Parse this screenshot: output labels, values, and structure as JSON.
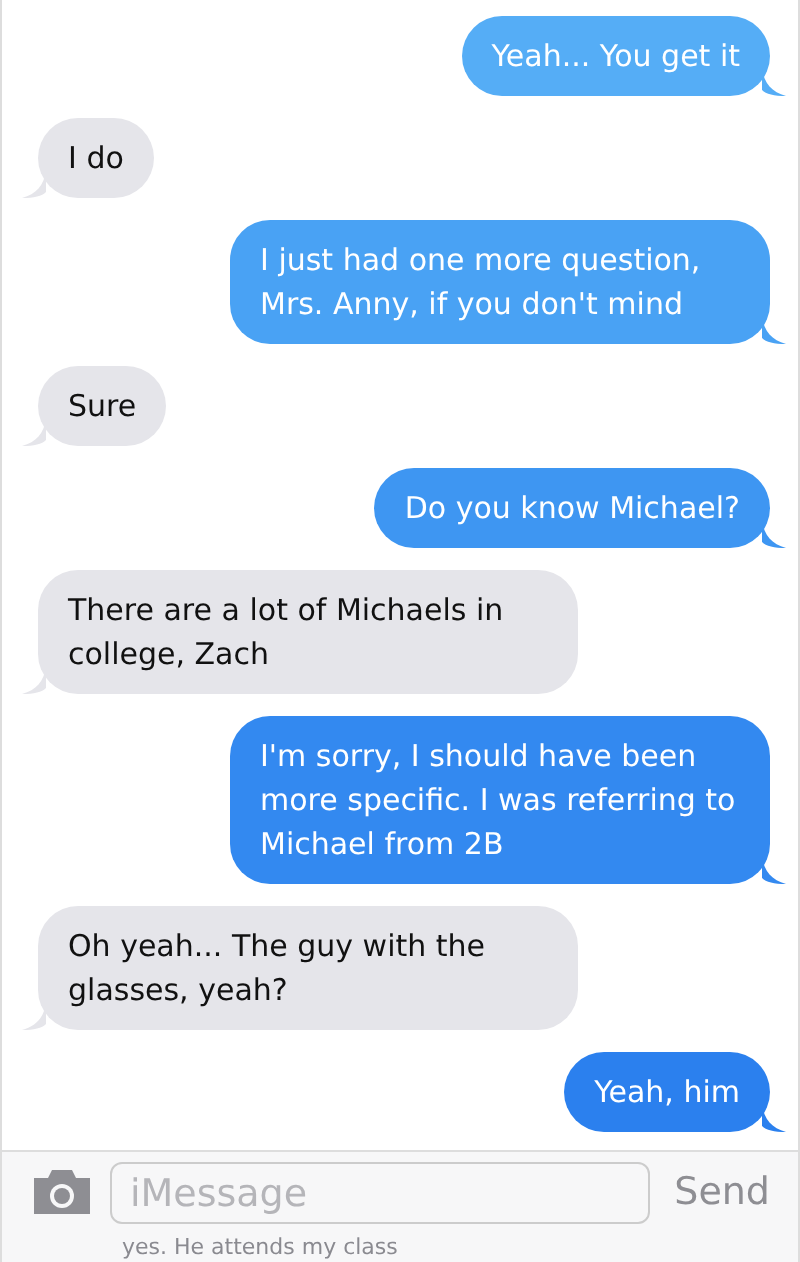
{
  "messages": [
    {
      "kind": "sent",
      "text": "Yeah... You get it"
    },
    {
      "kind": "received",
      "text": "I do"
    },
    {
      "kind": "sent",
      "text": "I just had one more question, Mrs. Anny, if you don't mind"
    },
    {
      "kind": "received",
      "text": "Sure"
    },
    {
      "kind": "sent",
      "text": "Do you know Michael?"
    },
    {
      "kind": "received",
      "text": "There are a lot of Michaels in college, Zach"
    },
    {
      "kind": "sent",
      "text": "I'm sorry, I should have been more specific. I was referring to Michael from 2B"
    },
    {
      "kind": "received",
      "text": "Oh yeah... The guy with the glasses, yeah?"
    },
    {
      "kind": "sent",
      "text": "Yeah, him"
    }
  ],
  "hidden_message": "yes. He attends my class",
  "composer": {
    "placeholder": "iMessage",
    "send": "Send"
  }
}
